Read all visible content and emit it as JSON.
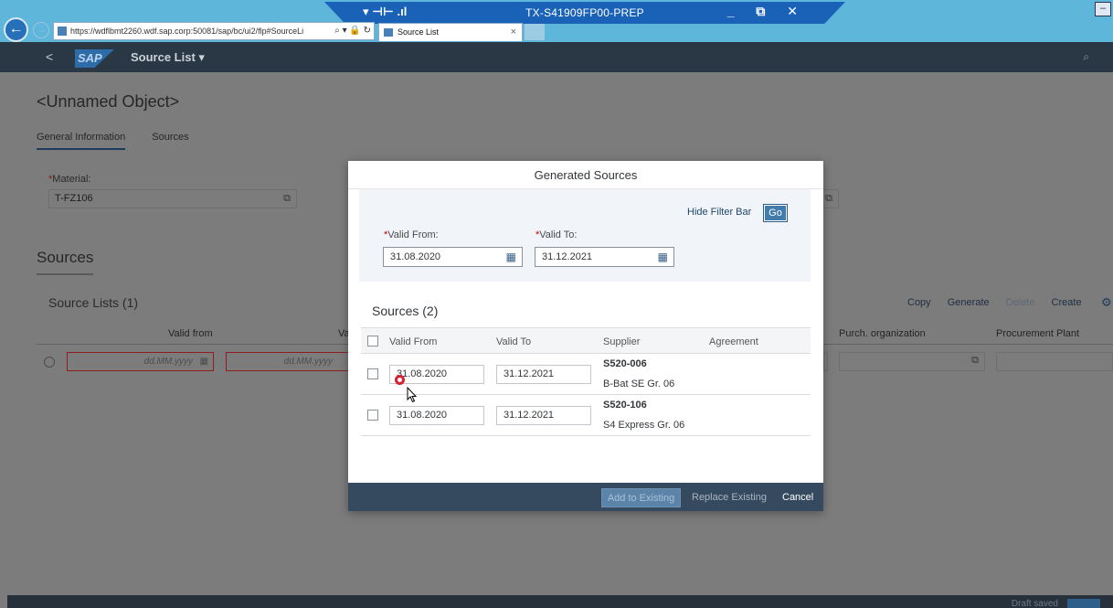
{
  "browser": {
    "url": "https://wdflbmt2260.wdf.sap.corp:50081/sap/bc/ui2/flp#SourceLi",
    "tab_title": "Source List",
    "tab_close": "×",
    "back_glyph": "←",
    "forward_glyph": "→",
    "address_tools": "⌕ ▾ 🔒 ↻",
    "remote_title": "TX-S41909FP00-PREP",
    "remote_left_icons": "▾ ⊣⊢ .ıl",
    "remote_right_icons": "_ ⧉ ✕",
    "corner_glyph": "–"
  },
  "shell": {
    "back": "<",
    "logo": "SAP",
    "app_title": "Source List ▾",
    "search_icon": "⌕"
  },
  "page": {
    "object_title": "<Unnamed Object>",
    "tabs": [
      "General Information",
      "Sources"
    ],
    "material_label": "Material:",
    "material_required": "*",
    "material_value": "T-FZ106",
    "value_help": "⧉",
    "sources_heading": "Sources",
    "source_lists_title": "Source Lists (1)",
    "toolbar": {
      "copy": "Copy",
      "generate": "Generate",
      "delete": "Delete",
      "create": "Create"
    },
    "gear_icon": "⚙",
    "columns": {
      "valid_from": "Valid from",
      "valid_to_partial": "Va",
      "purch_org": "Purch. organization",
      "procurement_plant": "Procurement Plant"
    },
    "date_placeholder": "dd.MM.yyyy",
    "calendar_icon": "▦",
    "footer_text": "Draft saved"
  },
  "dialog": {
    "title": "Generated Sources",
    "hide_filter_bar": "Hide Filter Bar",
    "go": "Go",
    "required_mark": "*",
    "valid_from_label": "Valid From:",
    "valid_to_label": "Valid To:",
    "valid_from_value": "31.08.2020",
    "valid_to_value": "31.12.2021",
    "calendar_icon": "▦",
    "sources_title": "Sources (2)",
    "columns": {
      "valid_from": "Valid From",
      "valid_to": "Valid To",
      "supplier": "Supplier",
      "agreement": "Agreement"
    },
    "rows": [
      {
        "valid_from": "31.08.2020",
        "valid_to": "31.12.2021",
        "supplier_id": "S520-006",
        "supplier_name": "B-Bat SE Gr. 06"
      },
      {
        "valid_from": "31.08.2020",
        "valid_to": "31.12.2021",
        "supplier_id": "S520-106",
        "supplier_name": "S4 Express Gr. 06"
      }
    ],
    "footer": {
      "add": "Add to Existing",
      "replace": "Replace Existing",
      "cancel": "Cancel"
    }
  }
}
